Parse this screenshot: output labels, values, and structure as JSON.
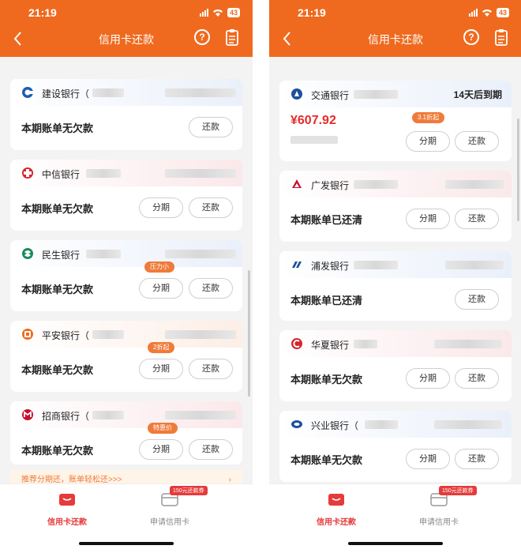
{
  "status_time": "21:19",
  "battery": "43",
  "title": "信用卡还款",
  "help_icon": "?",
  "colors": {
    "brand": "#ef6a1f",
    "amount": "#e52b2b",
    "tag": "#ef7b3a"
  },
  "left": {
    "cards": [
      {
        "bank": "建设银行（",
        "status": "本期账单无欠款",
        "buttons": [
          "还款"
        ],
        "tag": ""
      },
      {
        "bank": "中信银行",
        "status": "本期账单无欠款",
        "buttons": [
          "分期",
          "还款"
        ],
        "tag": ""
      },
      {
        "bank": "民生银行",
        "status": "本期账单无欠款",
        "buttons": [
          "分期",
          "还款"
        ],
        "tag": "压力小"
      },
      {
        "bank": "平安银行（",
        "status": "本期账单无欠款",
        "buttons": [
          "分期",
          "还款"
        ],
        "tag": "2折起"
      },
      {
        "bank": "招商银行（",
        "status": "本期账单无欠款",
        "buttons": [
          "分期",
          "还款"
        ],
        "tag": "特惠价"
      }
    ],
    "promo": "推荐分期还，账单轻松还>>>",
    "promo_arrow": "›"
  },
  "right": {
    "cards": [
      {
        "bank": "交通银行",
        "due": "14天后到期",
        "amount": "¥607.92",
        "buttons": [
          "分期",
          "还款"
        ],
        "tag": "3.1折起"
      },
      {
        "bank": "广发银行",
        "status": "本期账单已还清",
        "buttons": [
          "分期",
          "还款"
        ]
      },
      {
        "bank": "浦发银行",
        "status": "本期账单已还清",
        "buttons": [
          "还款"
        ]
      },
      {
        "bank": "华夏银行",
        "status": "本期账单无欠款",
        "buttons": [
          "分期",
          "还款"
        ]
      },
      {
        "bank": "兴业银行（",
        "status": "本期账单无欠款",
        "buttons": [
          "分期",
          "还款"
        ]
      }
    ]
  },
  "tabs": [
    {
      "label": "信用卡还款",
      "icon": "wallet-icon",
      "active": true
    },
    {
      "label": "申请信用卡",
      "icon": "card-icon",
      "active": false,
      "badge": "150元还款券"
    }
  ]
}
